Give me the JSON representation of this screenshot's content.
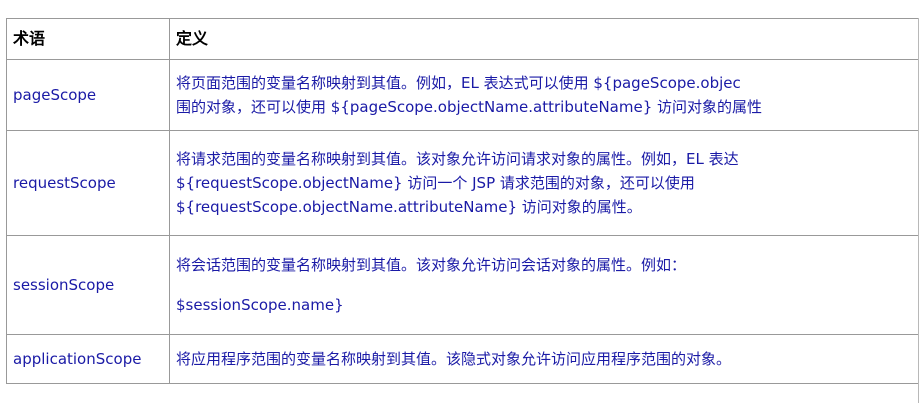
{
  "table": {
    "header": {
      "term": "术语",
      "definition": "定义"
    },
    "rows": [
      {
        "term": "pageScope",
        "lines": [
          "将页面范围的变量名称映射到其值。例如，EL 表达式可以使用 ${pageScope.objec",
          "围的对象，还可以使用 ${pageScope.objectName.attributeName} 访问对象的属性"
        ]
      },
      {
        "term": "requestScope",
        "lines": [
          "将请求范围的变量名称映射到其值。该对象允许访问请求对象的属性。例如，EL 表达",
          "${requestScope.objectName} 访问一个 JSP 请求范围的对象，还可以使用",
          "${requestScope.objectName.attributeName} 访问对象的属性。"
        ]
      },
      {
        "term": "sessionScope",
        "lines": [
          "将会话范围的变量名称映射到其值。该对象允许访问会话对象的属性。例如：",
          "$sessionScope.name}"
        ]
      },
      {
        "term": "applicationScope",
        "lines": [
          "将应用程序范围的变量名称映射到其值。该隐式对象允许访问应用程序范围的对象。"
        ]
      }
    ]
  }
}
